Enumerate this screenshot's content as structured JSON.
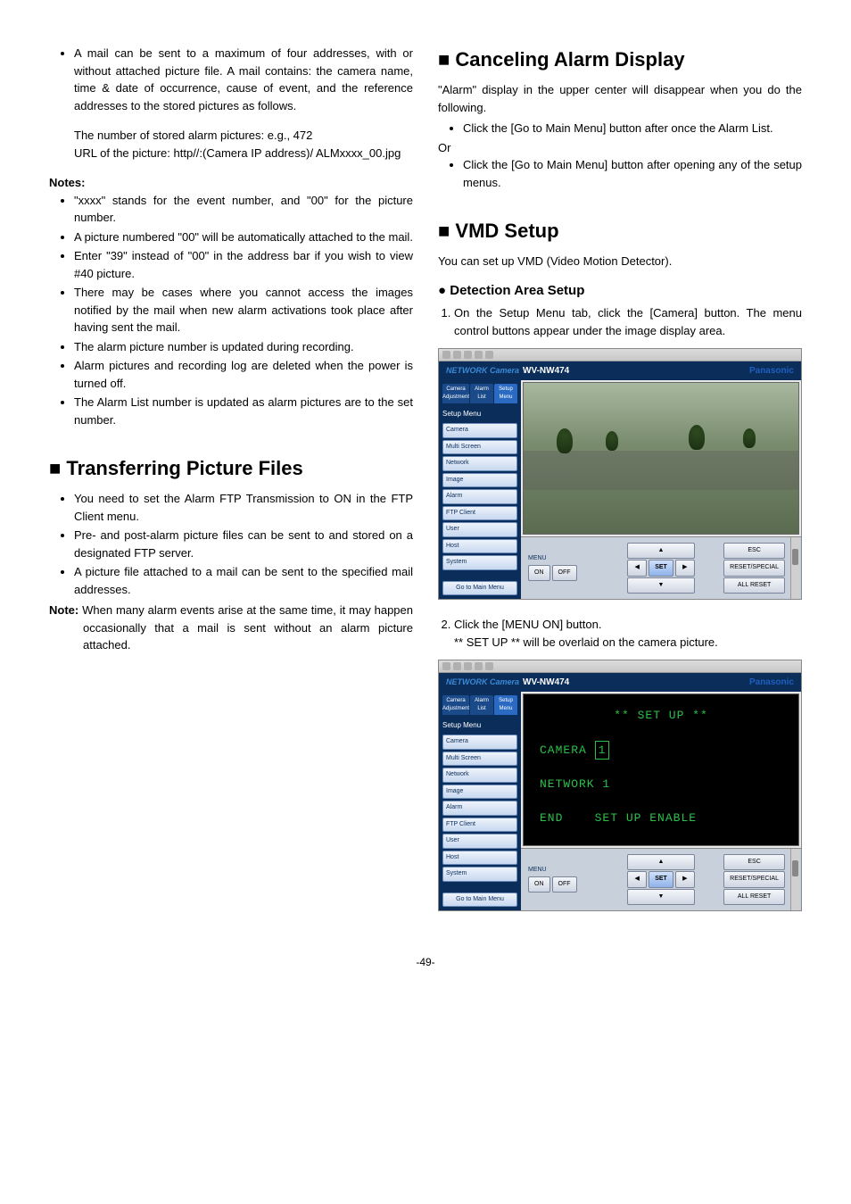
{
  "left": {
    "top_bullets": [
      "A mail can be sent to a maximum of four addresses, with or without attached picture file.\nA mail contains: the camera name, time & date of occurrence, cause of event, and the reference addresses to the stored pictures as follows."
    ],
    "sub_lines": [
      "The number of stored alarm pictures: e.g., 472",
      "URL of the picture: http//:(Camera IP address)/ ALMxxxx_00.jpg"
    ],
    "notes_label": "Notes:",
    "notes": [
      "\"xxxx\" stands for the event number, and \"00\" for the picture number.",
      "A picture numbered \"00\" will be automatically attached to the mail.",
      "Enter \"39\" instead of \"00\" in the address bar if you wish to view #40 picture.",
      "There may be cases where you cannot access the images notified by the mail when new alarm activations took place after having sent the mail.",
      "The alarm picture number is updated during recording.",
      "Alarm pictures and recording log are deleted when the power is turned off.",
      "The Alarm List number is updated as alarm pictures are to the set number."
    ],
    "h_transfer": "Transferring Picture Files",
    "transfer_bullets": [
      "You need to set the Alarm FTP Transmission to ON in the FTP Client menu.",
      "Pre- and post-alarm picture files can be sent to and stored on a designated FTP server.",
      "A picture file attached to a mail can be sent to the specified mail addresses."
    ],
    "transfer_note_label": "Note:",
    "transfer_note": "When many alarm events arise at the same time, it may happen occasionally that a mail is sent without an alarm picture attached."
  },
  "right": {
    "h_cancel": "Canceling Alarm Display",
    "cancel_intro": "\"Alarm\" display in the upper center will disappear when you do the following.",
    "cancel_bullets": [
      "Click the [Go to Main Menu] button after once the Alarm List."
    ],
    "or": "Or",
    "cancel_bullets2": [
      "Click the [Go to Main Menu] button after opening any of the setup menus."
    ],
    "h_vmd": "VMD Setup",
    "vmd_intro": "You can set up VMD (Video Motion Detector).",
    "h_detect": "Detection Area Setup",
    "steps": [
      "On the Setup Menu tab, click the [Camera] button. The menu control buttons appear under the image display area.",
      "Click the [MENU ON] button.\n** SET UP ** will be overlaid on the camera picture."
    ]
  },
  "shot": {
    "logo": "NETWORK Camera",
    "model": "WV-NW474",
    "brand": "Panasonic",
    "tabs": [
      "Camera Adjustment",
      "Alarm List",
      "Setup Menu"
    ],
    "side_title": "Setup Menu",
    "side_items": [
      "Camera",
      "Multi Screen",
      "Network",
      "Image",
      "Alarm",
      "FTP Client",
      "User",
      "Host",
      "System"
    ],
    "go_main": "Go to Main Menu",
    "menu_label": "MENU",
    "on": "ON",
    "off": "OFF",
    "set": "SET",
    "esc": "ESC",
    "reset": "RESET/SPECIAL",
    "allreset": "ALL RESET",
    "osd_title": "** SET UP **",
    "osd_cam": "CAMERA",
    "osd_cam_v": "1",
    "osd_net": "NETWORK 1",
    "osd_end": "END",
    "osd_enable": "SET UP ENABLE"
  },
  "page": "-49-"
}
